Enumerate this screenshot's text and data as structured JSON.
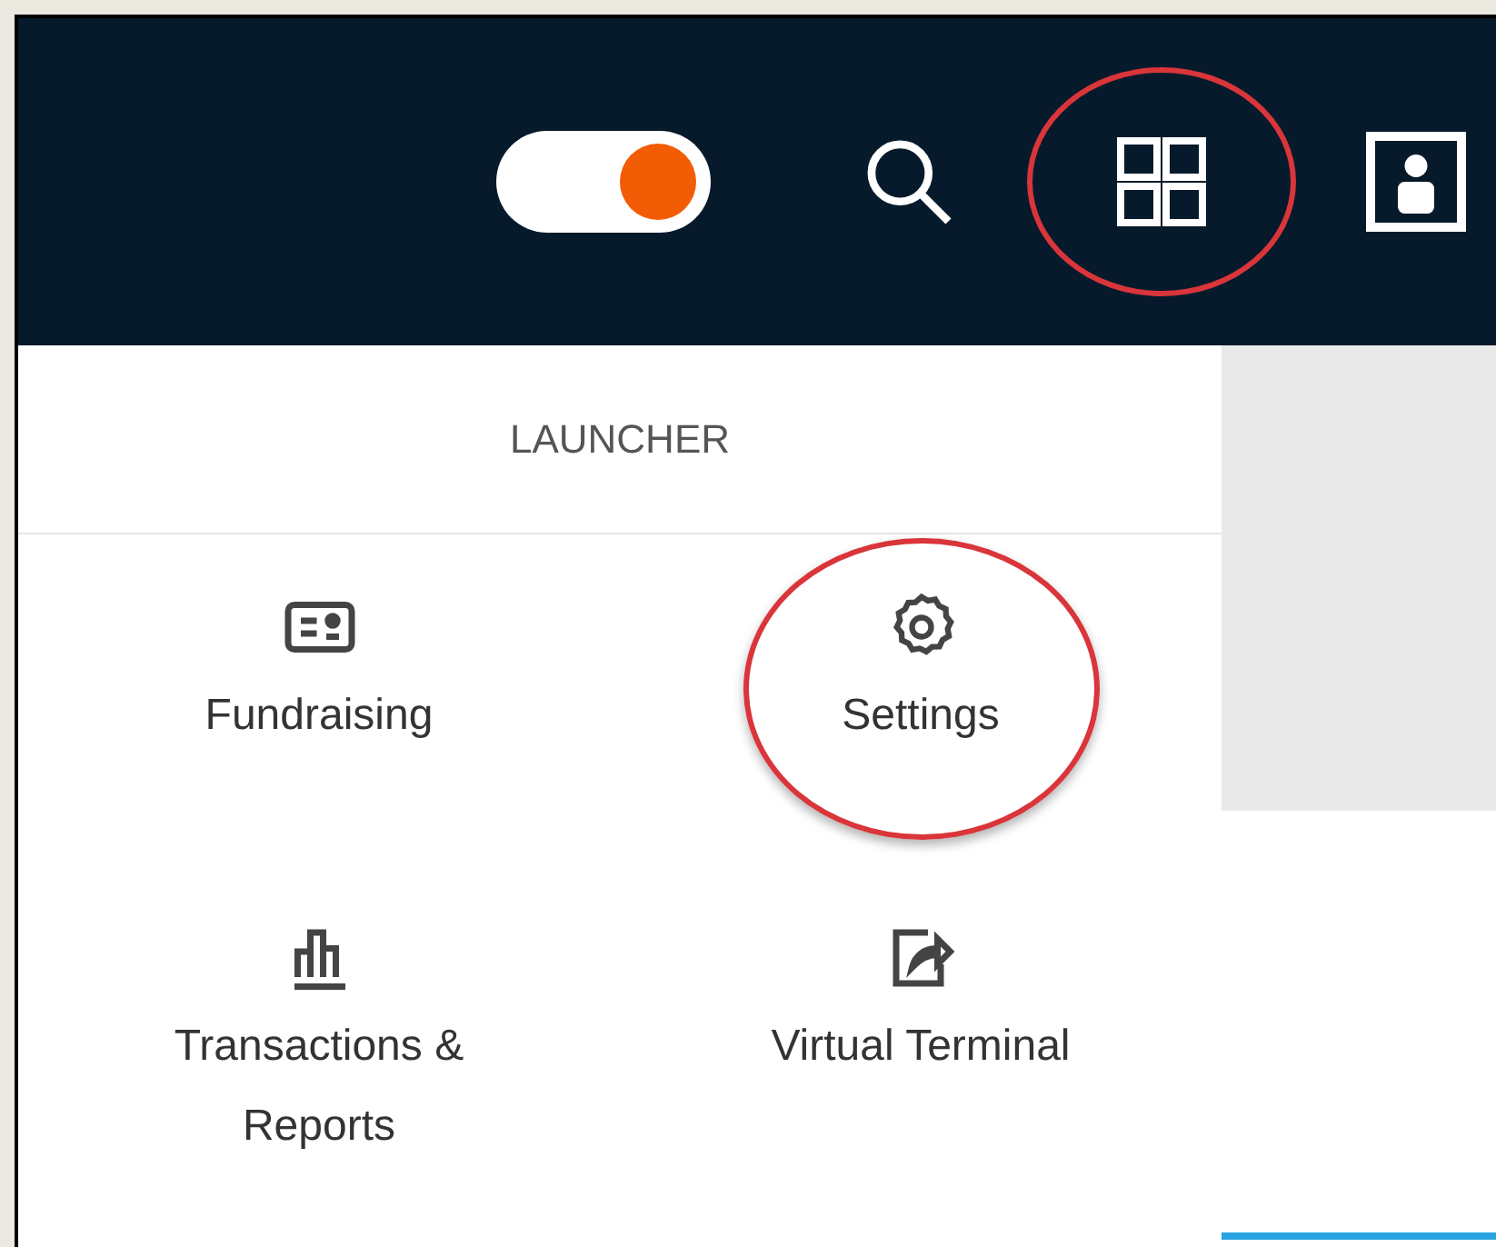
{
  "header": {
    "theme_toggle": {
      "on": true
    },
    "apps_button": {
      "highlighted": true
    }
  },
  "launcher": {
    "title": "LAUNCHER",
    "items": [
      {
        "label": "Fundraising",
        "kind": "card",
        "highlighted": false
      },
      {
        "label": "Settings",
        "kind": "gear",
        "highlighted": true
      },
      {
        "label": "Transactions & Reports",
        "kind": "chart",
        "highlighted": false
      },
      {
        "label": "Virtual Terminal",
        "kind": "share",
        "highlighted": false
      }
    ]
  }
}
